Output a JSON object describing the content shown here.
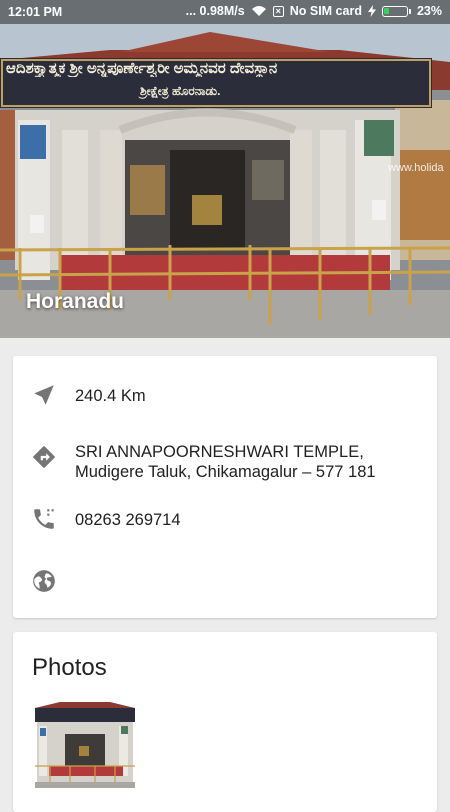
{
  "status_bar": {
    "time": "12:01 PM",
    "network_speed": "... 0.98M/s",
    "sim_status": "No SIM card",
    "battery_percent": "23%",
    "battery_level": 0.23
  },
  "hero": {
    "title": "Horanadu",
    "signboard_line1": "ಆದಿಶಕ್ತ್ಯಾತ್ಮಕ ಶ್ರೀ ಅನ್ನಪೂರ್ಣೇಶ್ವರೀ ಅಮ್ಮನವರ ದೇವಸ್ಥಾನ",
    "signboard_line2": "ಶ್ರೀಕ್ಷೇತ್ರ ಹೊರನಾಡು.",
    "watermark": "www.holida"
  },
  "details": {
    "distance": "240.4 Km",
    "address_line1": "SRI ANNAPOORNESHWARI TEMPLE,",
    "address_line2": "Mudigere Taluk, Chikamagalur – 577 181",
    "phone": "08263 269714",
    "website": ""
  },
  "photos": {
    "title": "Photos"
  },
  "icons": {
    "distance": "navigation-arrow-icon",
    "address": "directions-icon",
    "phone": "phone-icon",
    "website": "globe-icon"
  },
  "colors": {
    "icon_gray": "#757575",
    "text": "#212121",
    "background": "#ececec",
    "battery_fill": "#3bd15b"
  }
}
